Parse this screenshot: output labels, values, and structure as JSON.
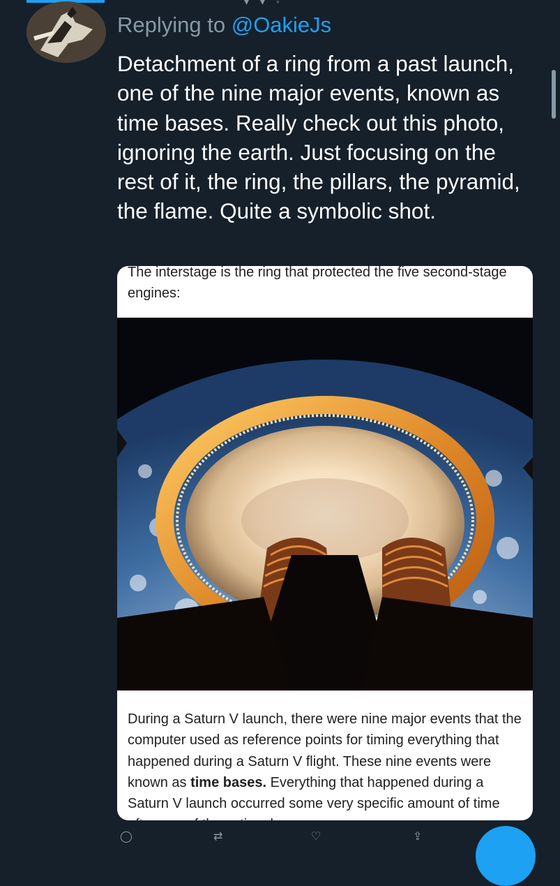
{
  "reply": {
    "prefix": "Replying to",
    "handle": "@OakieJs"
  },
  "tweet": {
    "text": "Detachment of a ring from a past launch, one of the nine major events, known as time bases. Really check out this photo, ignoring the earth. Just focusing on the rest of it, the ring, the pillars, the pyramid, the flame. Quite a symbolic shot."
  },
  "card": {
    "top_text": "The interstage is the ring that protected the five second-stage engines:",
    "bottom_text_before": "During a Saturn V launch, there were nine major events that the computer used as reference points for timing everything that happened during a Saturn V flight. These nine events were known as ",
    "bottom_text_bold": "time bases.",
    "bottom_text_after": " Everything that happened during a Saturn V launch occurred some very specific amount of time after one of these time bases"
  },
  "colors": {
    "background": "#15202b",
    "accent": "#1da1f2",
    "muted": "#8899a6"
  },
  "icons": {
    "reply": "reply-icon",
    "retweet": "retweet-icon",
    "like": "like-icon",
    "share": "share-icon",
    "compose": "compose-icon"
  }
}
